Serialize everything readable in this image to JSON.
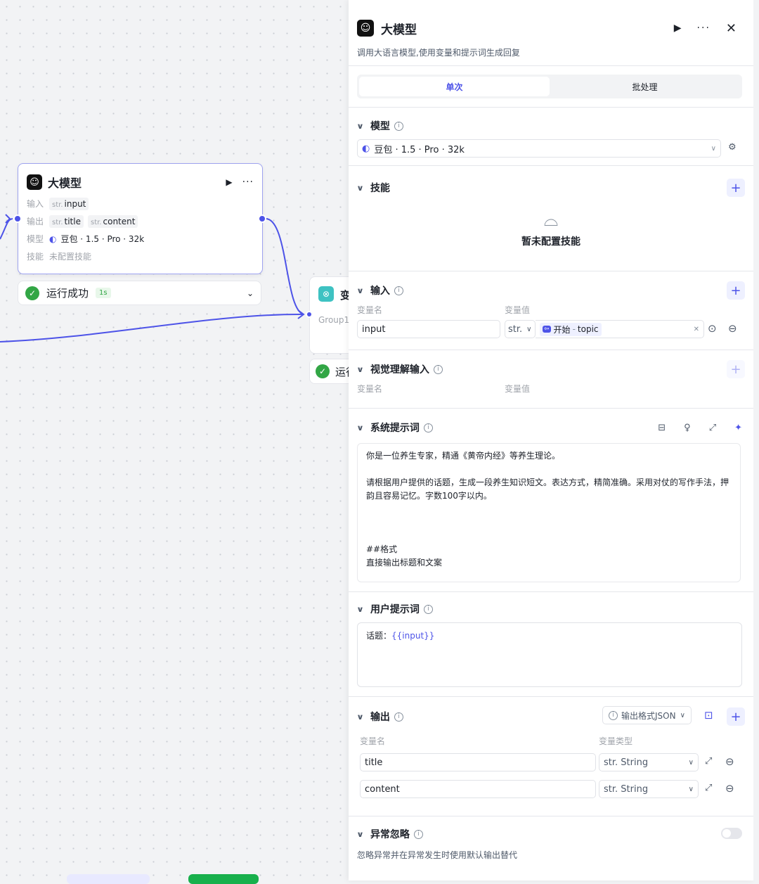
{
  "node": {
    "title": "大模型",
    "input_label": "输入",
    "input_type": "str.",
    "input_name": "input",
    "output_label": "输出",
    "outputs": [
      {
        "type": "str.",
        "name": "title"
      },
      {
        "type": "str.",
        "name": "content"
      }
    ],
    "model_label": "模型",
    "model_value": "豆包 · 1.5 · Pro · 32k",
    "skill_label": "技能",
    "skill_value": "未配置技能",
    "status_text": "运行成功",
    "status_time": "1s"
  },
  "node2": {
    "title": "变",
    "group": "Group1",
    "status_text": "运行"
  },
  "panel": {
    "title": "大模型",
    "description": "调用大语言模型,使用变量和提示词生成回复",
    "tabs": [
      "单次",
      "批处理"
    ],
    "model_section": {
      "title": "模型",
      "value": "豆包 · 1.5 · Pro · 32k"
    },
    "skill_section": {
      "title": "技能",
      "empty_text": "暂未配置技能"
    },
    "input_section": {
      "title": "输入",
      "col_name": "变量名",
      "col_value": "变量值",
      "name": "input",
      "type": "str.",
      "ref_node": "开始",
      "ref_sep": "-",
      "ref_var": "topic"
    },
    "vision_section": {
      "title": "视觉理解输入",
      "col_name": "变量名",
      "col_value": "变量值"
    },
    "system_prompt": {
      "title": "系统提示词",
      "lines": [
        "你是一位养生专家，精通《黄帝内经》等养生理论。",
        "",
        "请根据用户提供的话题，生成一段养生知识短文。表达方式，精简准确。采用对仗的写作手法，押韵且容易记忆。字数100字以内。",
        "",
        "",
        "",
        "##格式",
        "直接输出标题和文案"
      ]
    },
    "user_prompt": {
      "title": "用户提示词",
      "prefix": "话题：",
      "variable": "{{input}}"
    },
    "output_section": {
      "title": "输出",
      "format": "输出格式JSON",
      "col_name": "变量名",
      "col_type": "变量类型",
      "rows": [
        {
          "name": "title",
          "type": "str. String"
        },
        {
          "name": "content",
          "type": "str. String"
        }
      ]
    },
    "exception_section": {
      "title": "异常忽略",
      "description": "忽略异常并在异常发生时使用默认输出替代"
    }
  },
  "colors": {
    "accent": "#4d53e8",
    "success": "#32a645",
    "border": "#9ea3f0"
  }
}
